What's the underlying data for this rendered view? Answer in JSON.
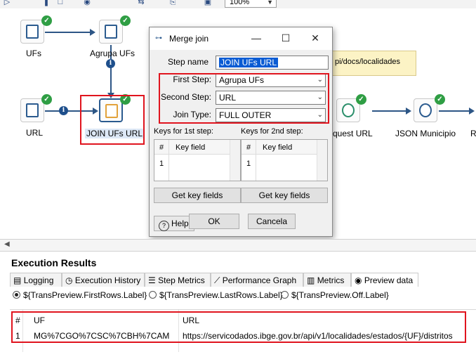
{
  "toolbar": {
    "zoom": "100%"
  },
  "canvas": {
    "steps": {
      "ufs": "UFs",
      "agrupa": "Agrupa UFs",
      "url": "URL",
      "join": "JOIN UFs URL",
      "request": "quest URL",
      "json": "JSON Municipio",
      "cut": "R"
    },
    "note": "pi/docs/localidades"
  },
  "dialog": {
    "title": "Merge join",
    "step_name_label": "Step name",
    "step_name_value": "JOIN UFs URL",
    "first_step_label": "First Step:",
    "first_step_value": "Agrupa UFs",
    "second_step_label": "Second Step:",
    "second_step_value": "URL",
    "join_type_label": "Join Type:",
    "join_type_value": "FULL OUTER",
    "keys1_label": "Keys for 1st step:",
    "keys2_label": "Keys for 2nd step:",
    "grid_hash": "#",
    "grid_key_field": "Key field",
    "grid_row1": "1",
    "get_key_fields": "Get key fields",
    "help": "Help",
    "ok": "OK",
    "cancel": "Cancela"
  },
  "execution": {
    "title": "Execution Results",
    "tabs": [
      "Logging",
      "Execution History",
      "Step Metrics",
      "Performance Graph",
      "Metrics",
      "Preview data"
    ],
    "radios": [
      "${TransPreview.FirstRows.Label}",
      "${TransPreview.LastRows.Label}",
      "${TransPreview.Off.Label}"
    ],
    "columns": [
      "#",
      "UF",
      "URL"
    ],
    "rows": [
      [
        "1",
        "MG%7CGO%7CSC%7CBH%7CAM",
        "https://servicodados.ibge.gov.br/api/v1/localidades/estados/{UF}/distritos"
      ]
    ]
  },
  "colors": {
    "highlight_border": "#e0141e",
    "hop": "#2d5686",
    "ok_badge": "#2f9e44"
  }
}
